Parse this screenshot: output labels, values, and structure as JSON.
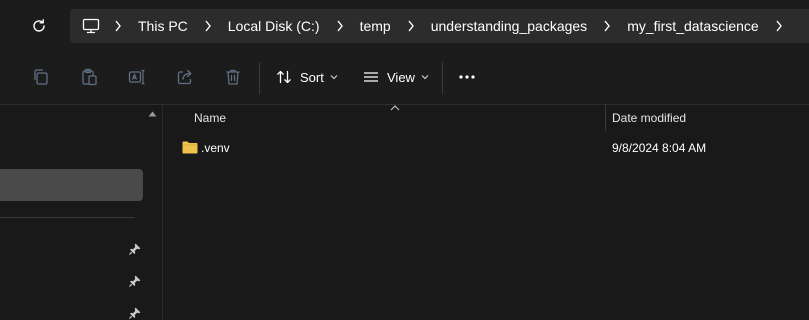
{
  "address_bar": {
    "crumbs": [
      "This PC",
      "Local Disk (C:)",
      "temp",
      "understanding_packages",
      "my_first_datascience"
    ]
  },
  "toolbar": {
    "sort_label": "Sort",
    "view_label": "View",
    "icons": [
      "copy-icon",
      "paste-icon",
      "rename-icon",
      "share-icon",
      "delete-icon",
      "more-options-icon"
    ]
  },
  "columns": {
    "name": "Name",
    "date_modified": "Date modified"
  },
  "files": [
    {
      "name": ".venv",
      "date_modified": "9/8/2024 8:04 AM",
      "type": "folder"
    }
  ],
  "colors": {
    "background": "#191919",
    "address_box": "#2c2c2c",
    "nav_selected": "#4a4a4a",
    "folder": "#f0c24b",
    "disabled_icon": "#5f6f85"
  }
}
